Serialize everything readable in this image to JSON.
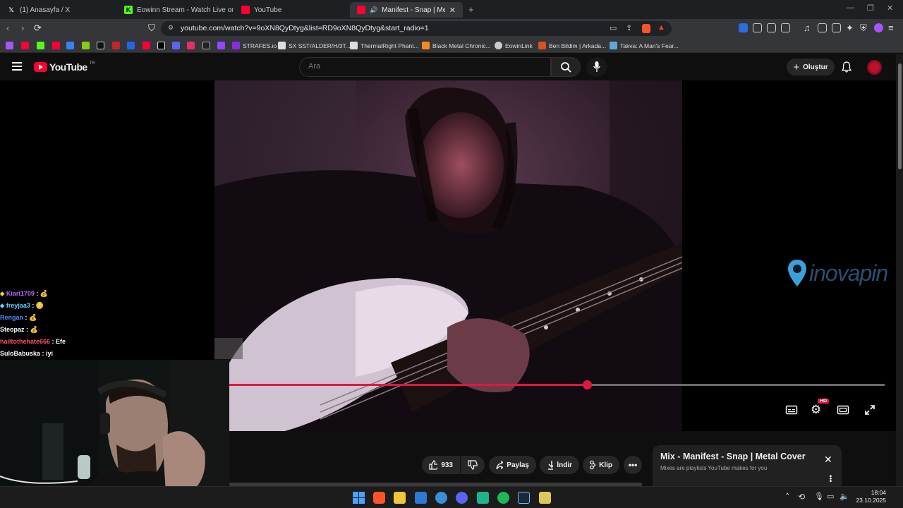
{
  "browser": {
    "tabs": [
      {
        "label": "(1) Anasayfa / X",
        "icon": "x-logo-icon",
        "color": "#ffffff"
      },
      {
        "label": "Eowinn Stream - Watch Live on Kick",
        "icon": "kick-logo-icon",
        "color": "#53fc18"
      },
      {
        "label": "YouTube",
        "icon": "youtube-logo-icon",
        "color": "#ff0033"
      },
      {
        "label": "Manifest - Snap | Metal Cover",
        "icon": "youtube-logo-icon",
        "color": "#ff0033",
        "active": true
      }
    ],
    "new_tab_label": "+",
    "url": "youtube.com/watch?v=9oXN8QyDtyg&list=RD9oXN8QyDtyg&start_radio=1",
    "bookmarks": [
      {
        "label": "STRAFES.io",
        "color": "#8a2be2"
      },
      {
        "label": "SX SST/ALDER/H/3T...",
        "color": "#dddddd"
      },
      {
        "label": "ThermalRight Phant...",
        "color": "#dddddd"
      },
      {
        "label": "Black Metal Chronic...",
        "color": "#f58b1f"
      },
      {
        "label": "EowinLink",
        "color": "#cccccc"
      },
      {
        "label": "Ben Bildim | Arkada...",
        "color": "#d9531e"
      },
      {
        "label": "Takva: A Man's Fear...",
        "color": "#5fa8d3"
      }
    ]
  },
  "youtube": {
    "logo_text": "YouTube",
    "region": "TR",
    "search_placeholder": "Ara",
    "create_label": "Oluştur",
    "video": {
      "progress": 0.546,
      "quality_badge": "HD"
    },
    "watermark": "inovapin",
    "actions": {
      "likes": "933",
      "share": "Paylaş",
      "download": "İndir",
      "clip": "Klip"
    },
    "mix": {
      "title": "Mix - Manifest - Snap | Metal Cover",
      "subtitle": "Mixes are playlists YouTube makes for you"
    }
  },
  "chat": [
    {
      "user": "Kiari1709",
      "message": "💰",
      "color": "#b569ff"
    },
    {
      "user": "freyjaa3",
      "message": "🪙",
      "color": "#5fd3ff"
    },
    {
      "user": "Rengan",
      "message": "💰",
      "color": "#4f8cff"
    },
    {
      "user": "Steopaz",
      "message": "💰",
      "color": "#ffffff"
    },
    {
      "user": "hailtothehate666",
      "message": "Efe",
      "color": "#ff4d6d"
    },
    {
      "user": "SuloBabuska",
      "message": "iyi",
      "color": "#ffffff"
    }
  ],
  "taskbar": {
    "time": "18:04",
    "date": "23.10.2025"
  },
  "colors": {
    "accent": "#e0173f",
    "kick_green": "#27e34a"
  }
}
